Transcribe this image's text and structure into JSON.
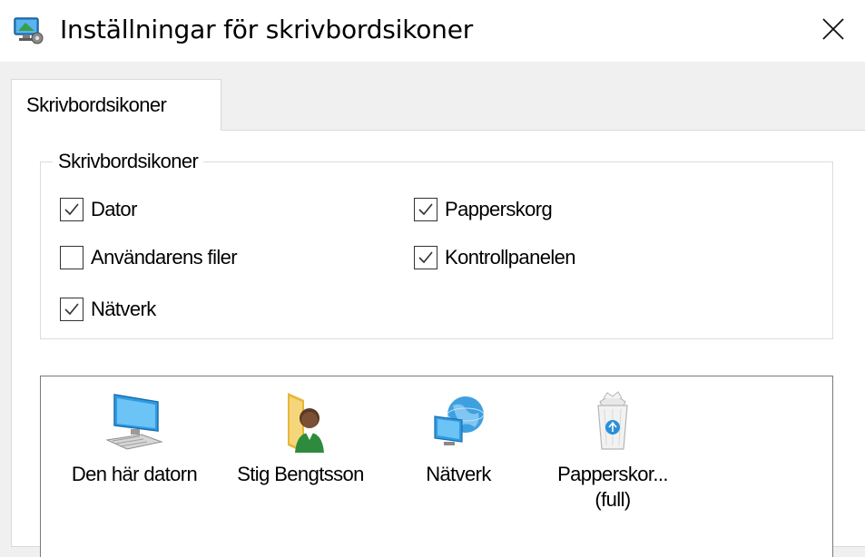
{
  "window": {
    "title": "Inställningar för skrivbordsikoner",
    "icons": {
      "app": "desktop-settings-icon",
      "close": "close-icon"
    }
  },
  "tabs": [
    {
      "label": "Skrivbordsikoner",
      "selected": true
    }
  ],
  "group": {
    "legend": "Skrivbordsikoner",
    "checkboxes": [
      {
        "label": "Dator",
        "checked": true
      },
      {
        "label": "Användarens filer",
        "checked": false
      },
      {
        "label": "Nätverk",
        "checked": true
      },
      {
        "label": "Papperskorg",
        "checked": true
      },
      {
        "label": "Kontrollpanelen",
        "checked": true
      }
    ]
  },
  "icon_list": [
    {
      "label": "Den här datorn",
      "icon": "computer-icon"
    },
    {
      "label": "Stig Bengtsson",
      "icon": "user-folder-icon"
    },
    {
      "label": "Nätverk",
      "icon": "network-icon"
    },
    {
      "label": "Papperskor...",
      "label2": "(full)",
      "icon": "recycle-bin-full-icon"
    }
  ],
  "colors": {
    "accent": "#1e8fd6",
    "check": "#333333"
  }
}
